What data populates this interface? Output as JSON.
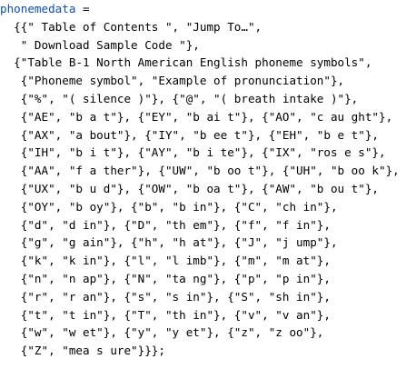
{
  "notebook": {
    "variable": "phonemedata",
    "assign_op": " =",
    "lines": [
      "  {{\" Table of Contents \", \"Jump To…\",",
      "   \" Download Sample Code \"},",
      "  {\"Table B-1 North American English phoneme symbols\",",
      "   {\"Phoneme symbol\", \"Example of pronunciation\"},",
      "   {\"%\", \"( silence )\"}, {\"@\", \"( breath intake )\"},",
      "   {\"AE\", \"b a t\"}, {\"EY\", \"b ai t\"}, {\"AO\", \"c au ght\"},",
      "   {\"AX\", \"a bout\"}, {\"IY\", \"b ee t\"}, {\"EH\", \"b e t\"},",
      "   {\"IH\", \"b i t\"}, {\"AY\", \"b i te\"}, {\"IX\", \"ros e s\"},",
      "   {\"AA\", \"f a ther\"}, {\"UW\", \"b oo t\"}, {\"UH\", \"b oo k\"},",
      "   {\"UX\", \"b u d\"}, {\"OW\", \"b oa t\"}, {\"AW\", \"b ou t\"},",
      "   {\"OY\", \"b oy\"}, {\"b\", \"b in\"}, {\"C\", \"ch in\"},",
      "   {\"d\", \"d in\"}, {\"D\", \"th em\"}, {\"f\", \"f in\"},",
      "   {\"g\", \"g ain\"}, {\"h\", \"h at\"}, {\"J\", \"j ump\"},",
      "   {\"k\", \"k in\"}, {\"l\", \"l imb\"}, {\"m\", \"m at\"},",
      "   {\"n\", \"n ap\"}, {\"N\", \"ta ng\"}, {\"p\", \"p in\"},",
      "   {\"r\", \"r an\"}, {\"s\", \"s in\"}, {\"S\", \"sh in\"},",
      "   {\"t\", \"t in\"}, {\"T\", \"th in\"}, {\"v\", \"v an\"},",
      "   {\"w\", \"w et\"}, {\"y\", \"y et\"}, {\"z\", \"z oo\"},",
      "   {\"Z\", \"mea s ure\"}}};"
    ]
  }
}
